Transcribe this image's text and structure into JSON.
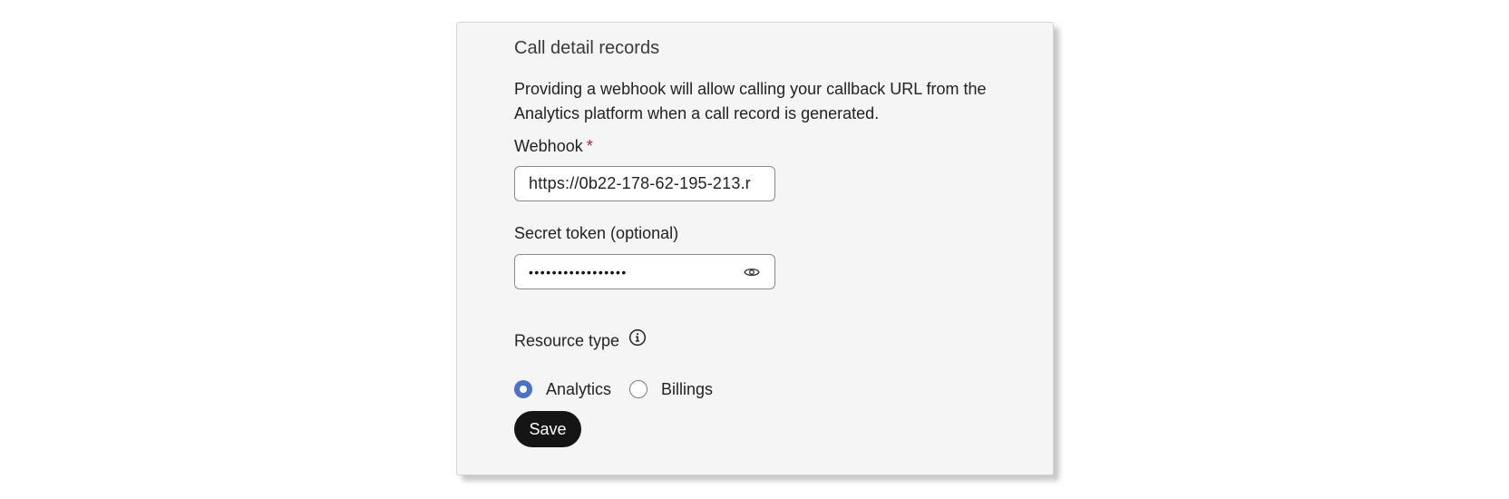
{
  "section": {
    "title": "Call detail records",
    "description": "Providing a webhook will allow calling your callback URL from the Analytics platform when a call record is generated."
  },
  "webhook": {
    "label": "Webhook",
    "required_marker": "*",
    "value": "https://0b22-178-62-195-213.r"
  },
  "secret_token": {
    "label": "Secret token (optional)",
    "masked_value": "•••••••••••••••••"
  },
  "resource_type": {
    "label": "Resource type",
    "options": [
      {
        "label": "Analytics",
        "selected": true
      },
      {
        "label": "Billings",
        "selected": false
      }
    ]
  },
  "actions": {
    "save_label": "Save"
  },
  "colors": {
    "accent": "#4a72c7",
    "required": "#b3261e",
    "button_bg": "#151515",
    "card_bg": "#f5f5f5"
  },
  "icons": {
    "password_toggle": "eye-icon",
    "info": "info-icon"
  }
}
